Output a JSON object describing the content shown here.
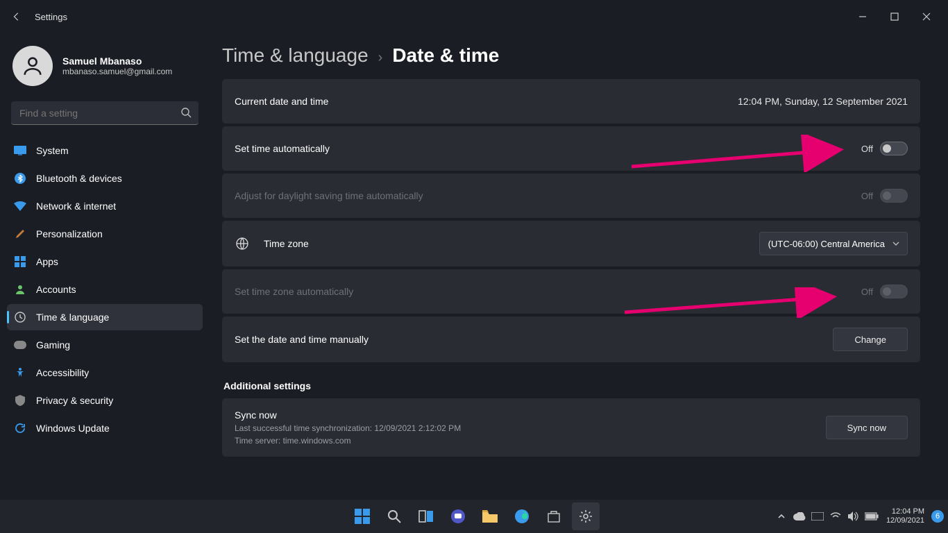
{
  "titlebar": {
    "title": "Settings"
  },
  "user": {
    "name": "Samuel Mbanaso",
    "email": "mbanaso.samuel@gmail.com"
  },
  "search": {
    "placeholder": "Find a setting"
  },
  "nav": {
    "items": [
      {
        "label": "System"
      },
      {
        "label": "Bluetooth & devices"
      },
      {
        "label": "Network & internet"
      },
      {
        "label": "Personalization"
      },
      {
        "label": "Apps"
      },
      {
        "label": "Accounts"
      },
      {
        "label": "Time & language"
      },
      {
        "label": "Gaming"
      },
      {
        "label": "Accessibility"
      },
      {
        "label": "Privacy & security"
      },
      {
        "label": "Windows Update"
      }
    ]
  },
  "breadcrumb": {
    "parent": "Time & language",
    "current": "Date & time"
  },
  "cards": {
    "current": {
      "label": "Current date and time",
      "value": "12:04 PM, Sunday, 12 September 2021"
    },
    "auto_time": {
      "label": "Set time automatically",
      "state": "Off"
    },
    "dst": {
      "label": "Adjust for daylight saving time automatically",
      "state": "Off"
    },
    "timezone": {
      "label": "Time zone",
      "value": "(UTC-06:00) Central America"
    },
    "auto_tz": {
      "label": "Set time zone automatically",
      "state": "Off"
    },
    "manual": {
      "label": "Set the date and time manually",
      "button": "Change"
    }
  },
  "additional": {
    "heading": "Additional settings",
    "sync": {
      "title": "Sync now",
      "line1": "Last successful time synchronization: 12/09/2021 2:12:02 PM",
      "line2": "Time server: time.windows.com",
      "button": "Sync now"
    }
  },
  "taskbar": {
    "clock_time": "12:04 PM",
    "clock_date": "12/09/2021",
    "notif_count": "6"
  }
}
